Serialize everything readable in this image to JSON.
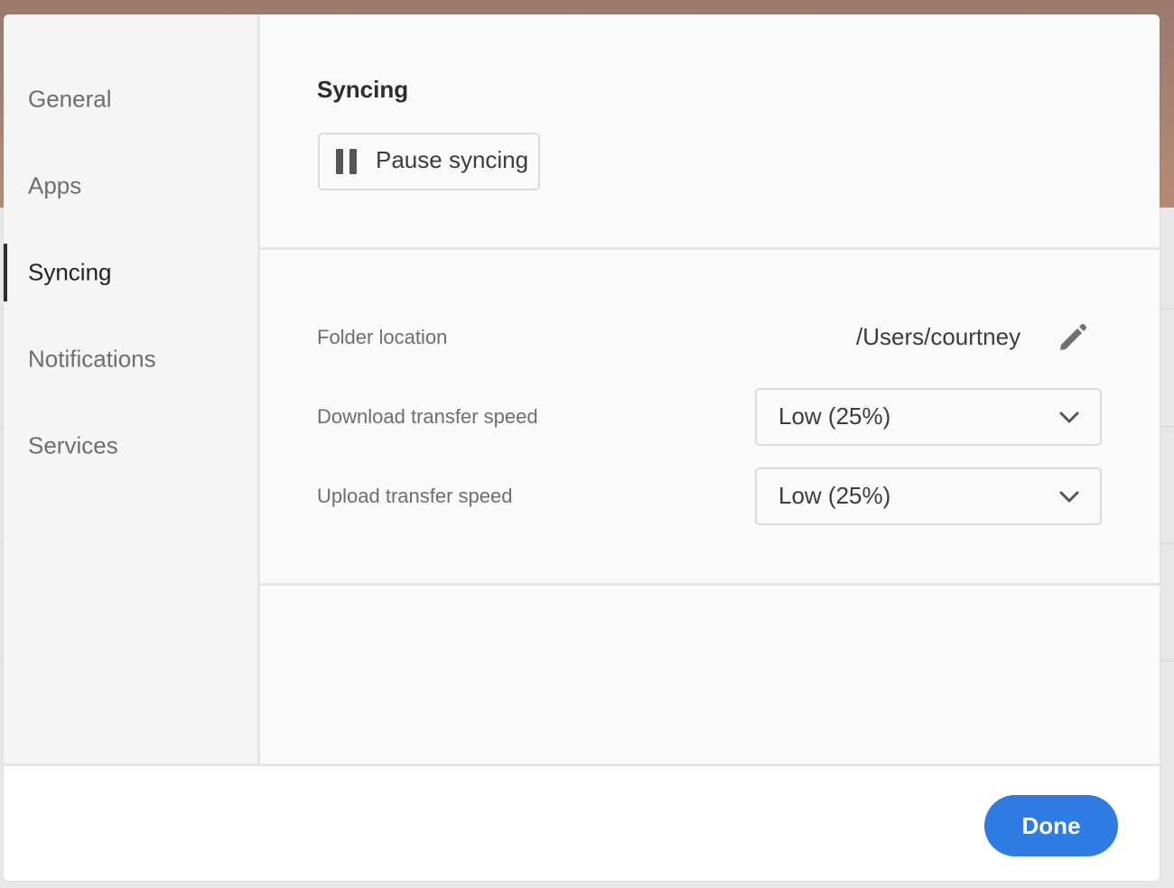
{
  "sidebar": {
    "items": [
      {
        "label": "General"
      },
      {
        "label": "Apps"
      },
      {
        "label": "Syncing"
      },
      {
        "label": "Notifications"
      },
      {
        "label": "Services"
      }
    ],
    "selected": "Syncing"
  },
  "content": {
    "title": "Syncing",
    "pause_button": {
      "label": "Pause syncing",
      "icon": "pause-icon"
    },
    "folder_location": {
      "label": "Folder location",
      "value": "/Users/courtney",
      "icon": "pencil-icon"
    },
    "download_speed": {
      "label": "Download transfer speed",
      "value": "Low (25%)"
    },
    "upload_speed": {
      "label": "Upload transfer speed",
      "value": "Low (25%)"
    }
  },
  "footer": {
    "done_label": "Done"
  },
  "colors": {
    "accent": "#2d7be3",
    "selected_indicator": "#2c2c2c",
    "backdrop_top": "#b48a76"
  }
}
